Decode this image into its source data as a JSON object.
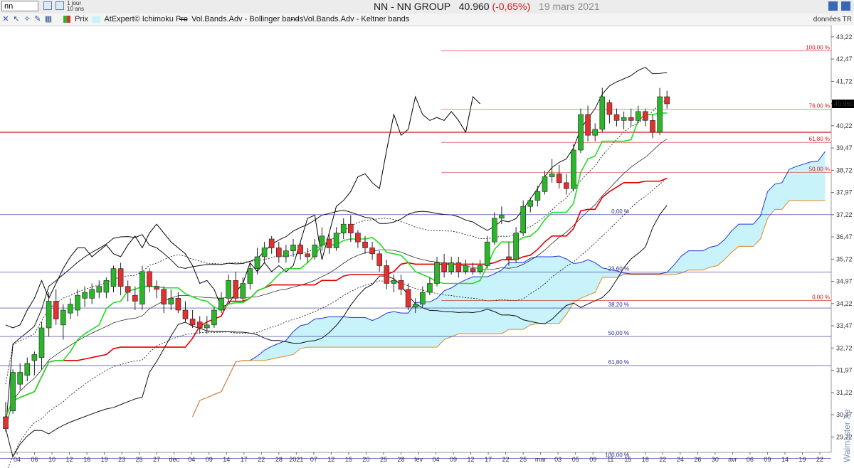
{
  "toolbar": {
    "symbol_value": "nn",
    "period_line1": "1 jour",
    "period_line2": "10 ans"
  },
  "header": {
    "name": "NN - NN GROUP",
    "last": "40.960",
    "change": "(-0,65%)",
    "date": "19 mars 2021"
  },
  "legend": {
    "prix": "Prix",
    "ichimoku": "AtExpert© Ichimoku Pro",
    "bollinger": "Vol.Bands.Adv - Bollinger bands",
    "keltner": "Vol.Bands.Adv - Keltner bands",
    "source": "données TR"
  },
  "watermark": "Waimaster Xe",
  "colors": {
    "up": "#2bb52b",
    "down": "#e03030",
    "kijun": "#e00000",
    "tenkan": "#22dd22",
    "cloud": "#c8f3fb",
    "cloud_upper": "#2233dd",
    "cloud_lower": "#e08a20",
    "fib_blue": "#2a2a9a",
    "fib_red": "#cc2020",
    "price_flag": "#000000"
  },
  "chart_data": {
    "type": "candlestick",
    "ylim": [
      29.2,
      43.6
    ],
    "y_ticks": [
      "43,22",
      "42,47",
      "41,72",
      "40,97",
      "40,22",
      "39,47",
      "38,72",
      "37,97",
      "37,22",
      "36,47",
      "35,72",
      "34,97",
      "34,22",
      "33,47",
      "32,72",
      "31,97",
      "31,22",
      "30,47",
      "29,72"
    ],
    "x_ticks": [
      "04",
      "06",
      "10",
      "12",
      "16",
      "19",
      "23",
      "25",
      "27",
      "déc",
      "04",
      "09",
      "14",
      "17",
      "22",
      "28",
      "2021",
      "07",
      "12",
      "15",
      "20",
      "25",
      "28",
      "fév",
      "04",
      "09",
      "12",
      "17",
      "22",
      "25",
      "mar",
      "03",
      "05",
      "09",
      "11",
      "15",
      "18",
      "22",
      "24",
      "26",
      "30",
      "avr",
      "06",
      "09",
      "14",
      "19",
      "22"
    ],
    "last_price": "40.960",
    "candles": [
      [
        30.4,
        30.9,
        30.0,
        29.9
      ],
      [
        30.6,
        32.0,
        31.9,
        30.5
      ],
      [
        31.5,
        32.2,
        31.9,
        31.3
      ],
      [
        31.8,
        32.4,
        32.2,
        31.6
      ],
      [
        32.3,
        32.6,
        32.5,
        31.8
      ],
      [
        32.4,
        33.6,
        33.4,
        32.0
      ],
      [
        33.4,
        34.6,
        34.3,
        33.1
      ],
      [
        34.3,
        34.7,
        33.7,
        33.5
      ],
      [
        33.5,
        34.2,
        34.0,
        33.0
      ],
      [
        33.9,
        34.4,
        34.2,
        33.7
      ],
      [
        34.0,
        34.7,
        34.5,
        33.8
      ],
      [
        34.4,
        34.8,
        34.6,
        34.1
      ],
      [
        34.4,
        34.9,
        34.7,
        34.2
      ],
      [
        34.6,
        35.0,
        34.8,
        34.4
      ],
      [
        34.6,
        35.1,
        35.0,
        34.4
      ],
      [
        34.8,
        35.5,
        35.4,
        34.6
      ],
      [
        35.4,
        35.6,
        34.8,
        34.5
      ],
      [
        34.8,
        35.0,
        34.6,
        34.3
      ],
      [
        34.5,
        34.8,
        34.3,
        34.0
      ],
      [
        34.2,
        35.5,
        35.3,
        34.0
      ],
      [
        35.3,
        35.4,
        34.8,
        34.6
      ],
      [
        34.8,
        35.0,
        34.7,
        34.4
      ],
      [
        34.7,
        34.8,
        34.2,
        33.9
      ],
      [
        34.2,
        34.7,
        34.4,
        34.0
      ],
      [
        34.4,
        34.6,
        34.0,
        33.9
      ],
      [
        34.0,
        34.3,
        33.7,
        33.6
      ],
      [
        33.7,
        34.0,
        33.5,
        33.4
      ],
      [
        33.6,
        33.8,
        33.4,
        33.2
      ],
      [
        33.4,
        33.8,
        33.5,
        33.2
      ],
      [
        33.5,
        34.1,
        34.0,
        33.4
      ],
      [
        34.0,
        34.6,
        34.4,
        33.9
      ],
      [
        34.4,
        35.2,
        35.0,
        34.3
      ],
      [
        35.0,
        35.3,
        34.4,
        34.3
      ],
      [
        34.4,
        35.1,
        34.9,
        34.3
      ],
      [
        34.9,
        35.6,
        35.4,
        34.7
      ],
      [
        35.4,
        36.1,
        35.8,
        35.2
      ],
      [
        35.8,
        36.3,
        36.1,
        35.6
      ],
      [
        36.4,
        36.5,
        36.1,
        35.9
      ],
      [
        36.1,
        36.3,
        35.8,
        35.6
      ],
      [
        35.8,
        36.2,
        36.0,
        35.6
      ],
      [
        36.0,
        36.4,
        36.2,
        35.8
      ],
      [
        36.2,
        36.3,
        35.9,
        35.7
      ],
      [
        35.9,
        36.1,
        35.8,
        35.6
      ],
      [
        35.8,
        36.4,
        36.2,
        35.7
      ],
      [
        36.2,
        36.8,
        36.5,
        36.0
      ],
      [
        36.4,
        36.6,
        36.1,
        35.9
      ],
      [
        36.1,
        36.8,
        36.6,
        36.0
      ],
      [
        36.6,
        37.1,
        36.9,
        36.4
      ],
      [
        36.9,
        37.2,
        36.6,
        36.3
      ],
      [
        36.6,
        36.7,
        36.3,
        36.1
      ],
      [
        36.3,
        36.5,
        36.1,
        35.9
      ],
      [
        36.1,
        36.3,
        35.9,
        35.7
      ],
      [
        35.9,
        36.0,
        35.5,
        35.3
      ],
      [
        35.5,
        35.7,
        34.9,
        34.7
      ],
      [
        34.9,
        35.2,
        35.0,
        34.6
      ],
      [
        35.0,
        35.2,
        34.7,
        34.5
      ],
      [
        34.7,
        34.9,
        34.1,
        34.0
      ],
      [
        34.1,
        34.4,
        34.2,
        33.9
      ],
      [
        34.2,
        34.8,
        34.6,
        34.1
      ],
      [
        34.6,
        35.1,
        34.9,
        34.5
      ],
      [
        34.9,
        35.8,
        35.6,
        34.8
      ],
      [
        35.6,
        35.9,
        35.3,
        35.1
      ],
      [
        35.3,
        35.8,
        35.6,
        35.2
      ],
      [
        35.6,
        35.8,
        35.3,
        35.1
      ],
      [
        35.3,
        35.7,
        35.5,
        35.2
      ],
      [
        35.4,
        35.6,
        35.3,
        35.2
      ],
      [
        35.3,
        35.7,
        35.5,
        35.2
      ],
      [
        35.5,
        36.5,
        36.3,
        35.4
      ],
      [
        36.3,
        37.3,
        37.1,
        36.2
      ],
      [
        37.1,
        37.5,
        37.2,
        36.9
      ],
      [
        35.8,
        36.3,
        35.7,
        35.5
      ],
      [
        35.7,
        36.8,
        36.6,
        35.6
      ],
      [
        36.6,
        37.7,
        37.5,
        36.5
      ],
      [
        37.5,
        37.8,
        37.7,
        37.3
      ],
      [
        37.7,
        38.2,
        38.0,
        37.5
      ],
      [
        38.0,
        38.7,
        38.5,
        37.9
      ],
      [
        38.5,
        39.1,
        38.6,
        38.3
      ],
      [
        38.6,
        38.9,
        38.3,
        38.1
      ],
      [
        38.3,
        38.6,
        38.1,
        37.9
      ],
      [
        38.1,
        39.6,
        39.4,
        38.0
      ],
      [
        39.4,
        40.8,
        40.6,
        39.3
      ],
      [
        40.6,
        40.9,
        39.9,
        39.7
      ],
      [
        39.9,
        40.3,
        40.1,
        39.7
      ],
      [
        40.1,
        41.5,
        41.2,
        40.0
      ],
      [
        41.0,
        41.1,
        40.6,
        40.3
      ],
      [
        40.6,
        40.8,
        40.4,
        40.2
      ],
      [
        40.4,
        40.7,
        40.5,
        40.1
      ],
      [
        40.5,
        40.8,
        40.4,
        40.2
      ],
      [
        40.4,
        40.9,
        40.7,
        40.3
      ],
      [
        40.7,
        40.8,
        40.4,
        40.2
      ],
      [
        40.4,
        40.6,
        40.0,
        39.8
      ],
      [
        40.0,
        41.5,
        41.2,
        39.9
      ],
      [
        41.2,
        41.4,
        40.96,
        40.8
      ]
    ],
    "fib_left": {
      "levels": [
        {
          "label": "0,00 %",
          "value": 37.22
        },
        {
          "label": "23,60 %",
          "value": 35.28
        },
        {
          "label": "38,20 %",
          "value": 34.07
        },
        {
          "label": "50,00 %",
          "value": 33.11
        },
        {
          "label": "61,80 %",
          "value": 32.13
        },
        {
          "label": "100,00 %",
          "value": 29.0
        }
      ]
    },
    "fib_right": {
      "levels": [
        {
          "label": "100,00 %",
          "value": 42.75
        },
        {
          "label": "76,00 %",
          "value": 40.78
        },
        {
          "label": "61,80 %",
          "value": 39.66
        },
        {
          "label": "50,00 %",
          "value": 38.65
        },
        {
          "label": "0,00 %",
          "value": 34.32
        }
      ]
    },
    "horizontal_line": 40.0
  }
}
